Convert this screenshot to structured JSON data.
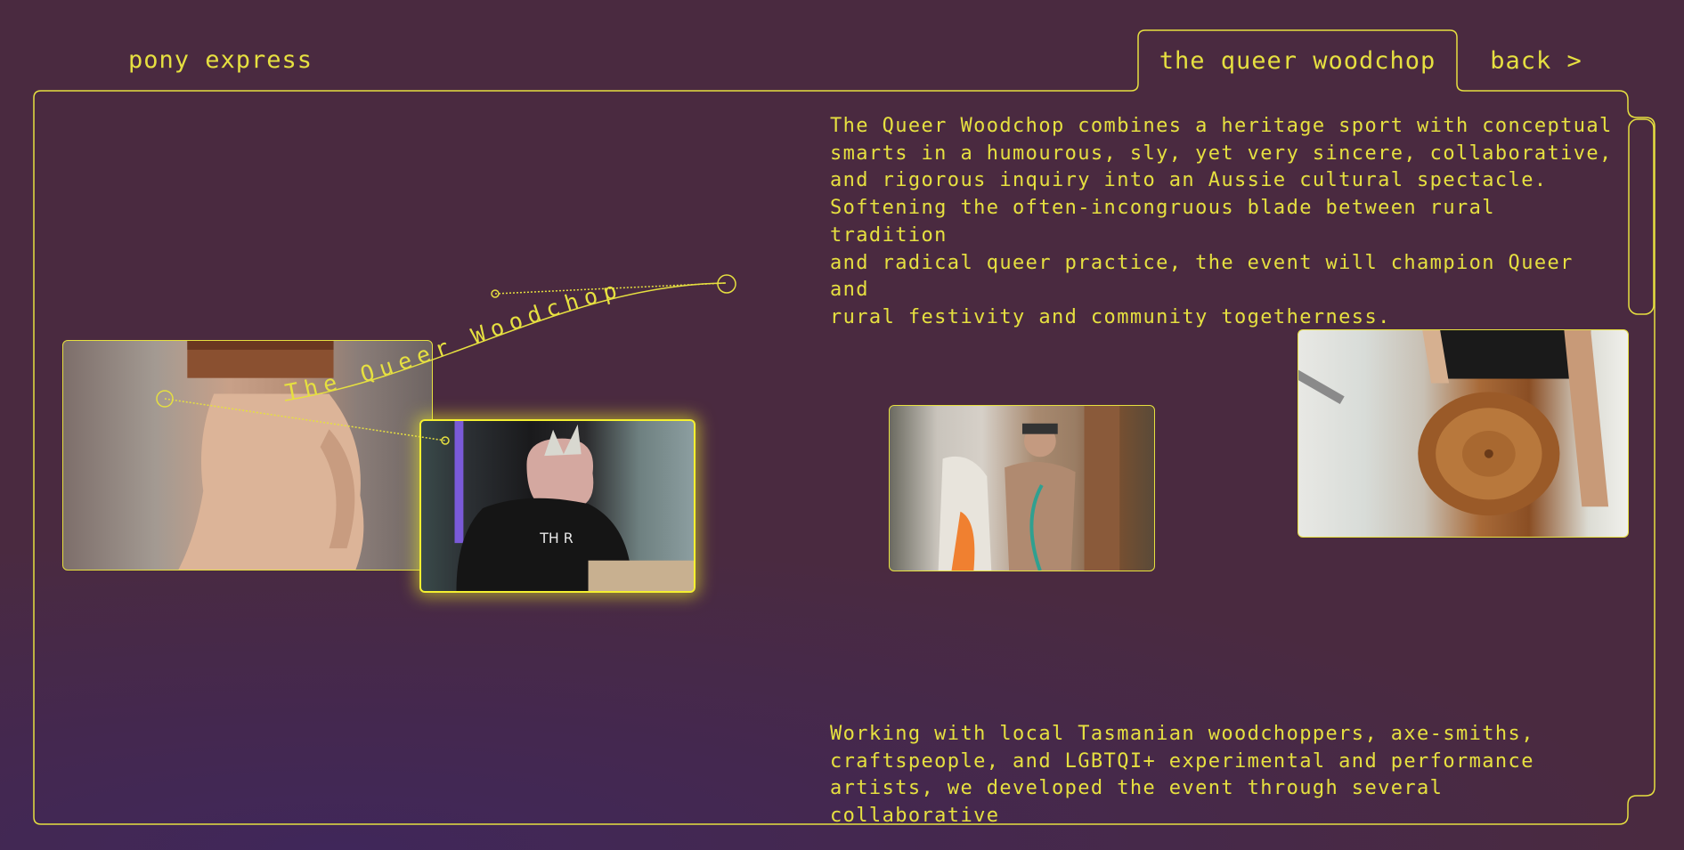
{
  "brand": "pony express",
  "nav": {
    "active_tab": "the queer woodchop",
    "back_label": "back >"
  },
  "project": {
    "curved_title": "The Queer Woodchop",
    "description_1": "The Queer Woodchop combines a heritage sport with conceptual\nsmarts in a humourous, sly, yet very sincere, collaborative,\nand rigorous inquiry into an Aussie cultural spectacle.\nSoftening the often-incongruous blade between rural tradition\nand radical queer practice, the event will champion Queer and\nrural festivity and community togetherness.",
    "description_2": "Working with local Tasmanian woodchoppers, axe-smiths,\ncraftspeople, and LGBTQI+ experimental and performance\nartists, we developed the event through several collaborative\ndevising sessions in rural Tasmania. Artists will learn"
  },
  "colors": {
    "background": "#4a2a40",
    "accent": "#e6e040"
  }
}
